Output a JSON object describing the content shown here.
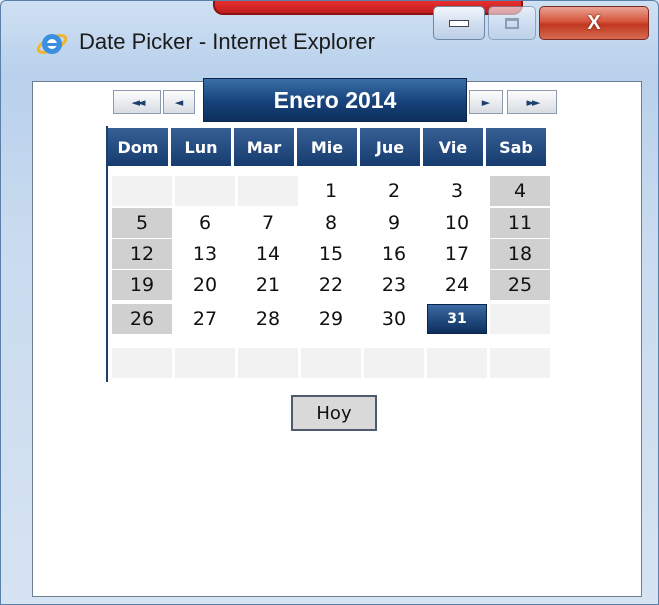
{
  "window": {
    "title": "Date Picker - Internet Explorer",
    "icon": "internet-explorer-icon",
    "controls": [
      "minimize-icon",
      "maximize-icon",
      "close-icon"
    ],
    "close_glyph": "X"
  },
  "calendar": {
    "month_title": "Enero 2014",
    "nav": {
      "prev_year": "◄◄",
      "prev_month": "◄",
      "next_month": "►",
      "next_year": "►►"
    },
    "weekdays": [
      "Dom",
      "Lun",
      "Mar",
      "Mie",
      "Jue",
      "Vie",
      "Sab"
    ],
    "weeks": [
      [
        "",
        "",
        "",
        "1",
        "2",
        "3",
        "4"
      ],
      [
        "5",
        "6",
        "7",
        "8",
        "9",
        "10",
        "11"
      ],
      [
        "12",
        "13",
        "14",
        "15",
        "16",
        "17",
        "18"
      ],
      [
        "19",
        "20",
        "21",
        "22",
        "23",
        "24",
        "25"
      ],
      [
        "26",
        "27",
        "28",
        "29",
        "30",
        "31",
        ""
      ],
      [
        "",
        "",
        "",
        "",
        "",
        "",
        ""
      ]
    ],
    "selected_day": "31",
    "today_button": "Hoy"
  },
  "colors": {
    "header_blue": "#163c6e",
    "selected_blue": "#0d2e5c",
    "weekend_gray": "#d0d0d0",
    "close_red": "#c0381f"
  }
}
